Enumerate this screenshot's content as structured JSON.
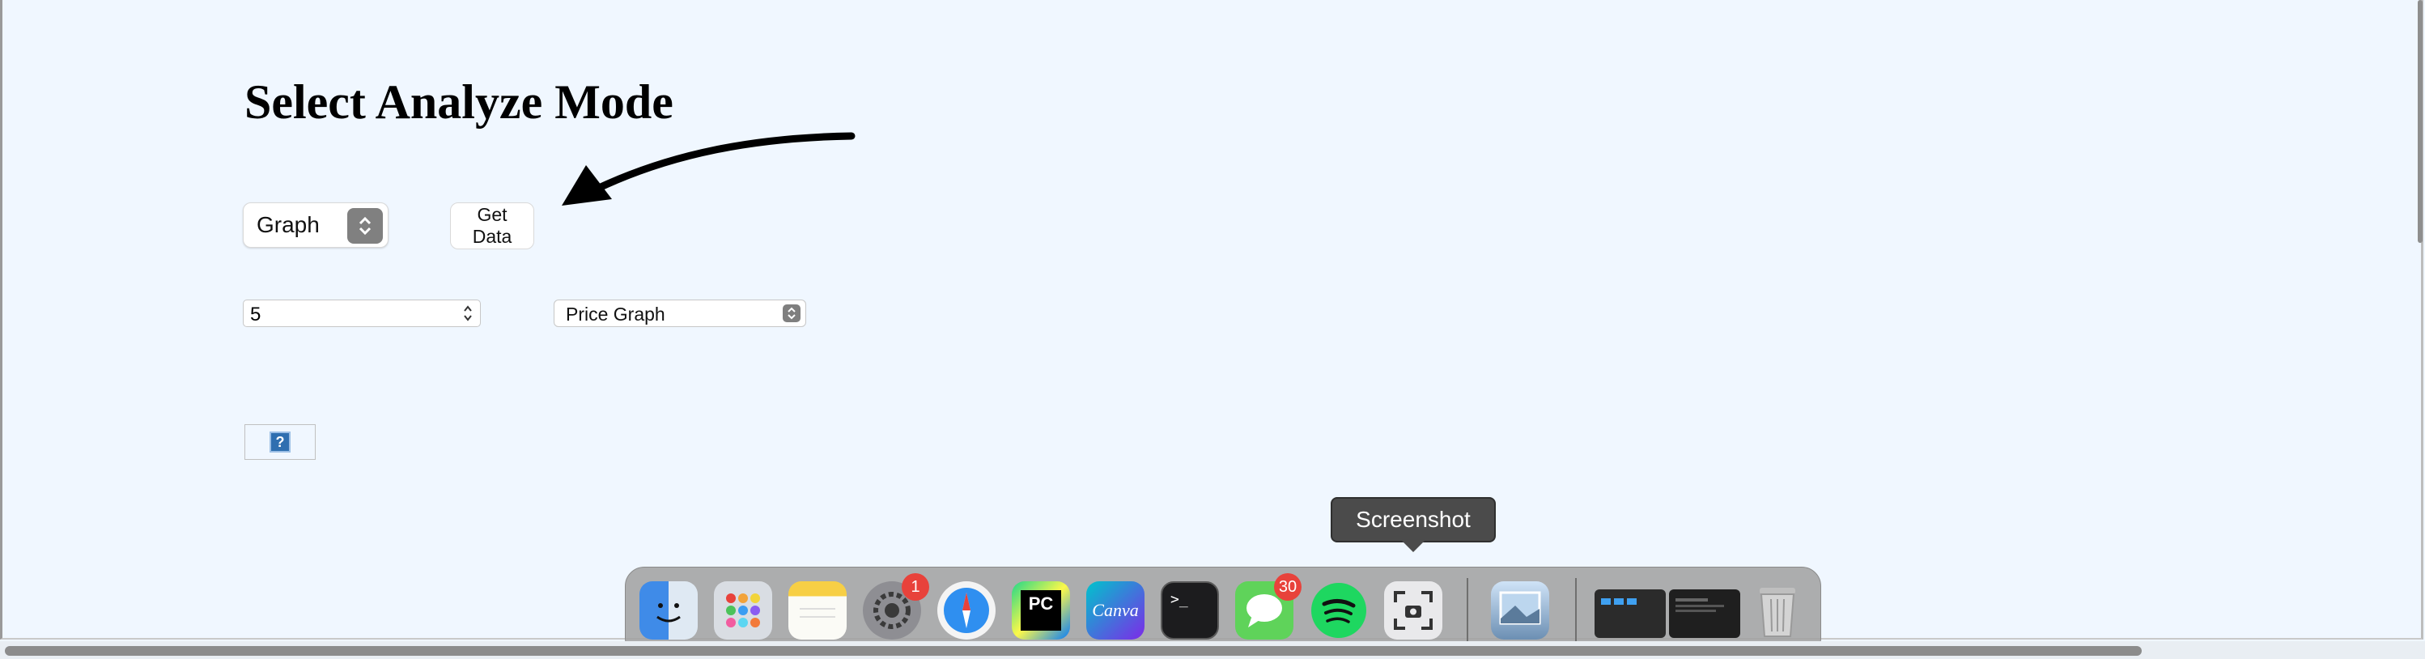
{
  "page": {
    "title": "Select Analyze Mode"
  },
  "controls": {
    "mode_select_value": "Graph",
    "get_data_label": "Get Data",
    "number_value": "5",
    "graph_type_value": "Price Graph",
    "help_label": "?"
  },
  "dock": {
    "tooltip": "Screenshot",
    "apps": [
      {
        "name": "finder-icon"
      },
      {
        "name": "launchpad-icon"
      },
      {
        "name": "notes-icon"
      },
      {
        "name": "system-settings-icon",
        "badge": "1"
      },
      {
        "name": "safari-icon"
      },
      {
        "name": "pycharm-icon",
        "label": "PC"
      },
      {
        "name": "canva-icon",
        "label": "Canva"
      },
      {
        "name": "terminal-icon",
        "label": ">_"
      },
      {
        "name": "messages-icon",
        "badge": "30"
      },
      {
        "name": "spotify-icon"
      },
      {
        "name": "screenshot-icon"
      },
      {
        "name": "preview-icon"
      },
      {
        "name": "finder-window-thumbnail"
      },
      {
        "name": "pycharm-window-thumbnail"
      },
      {
        "name": "trash-icon"
      }
    ]
  },
  "colors": {
    "background": "#f0f7ff",
    "badge": "#e8423b",
    "tooltip_bg": "#4b4b4b"
  }
}
